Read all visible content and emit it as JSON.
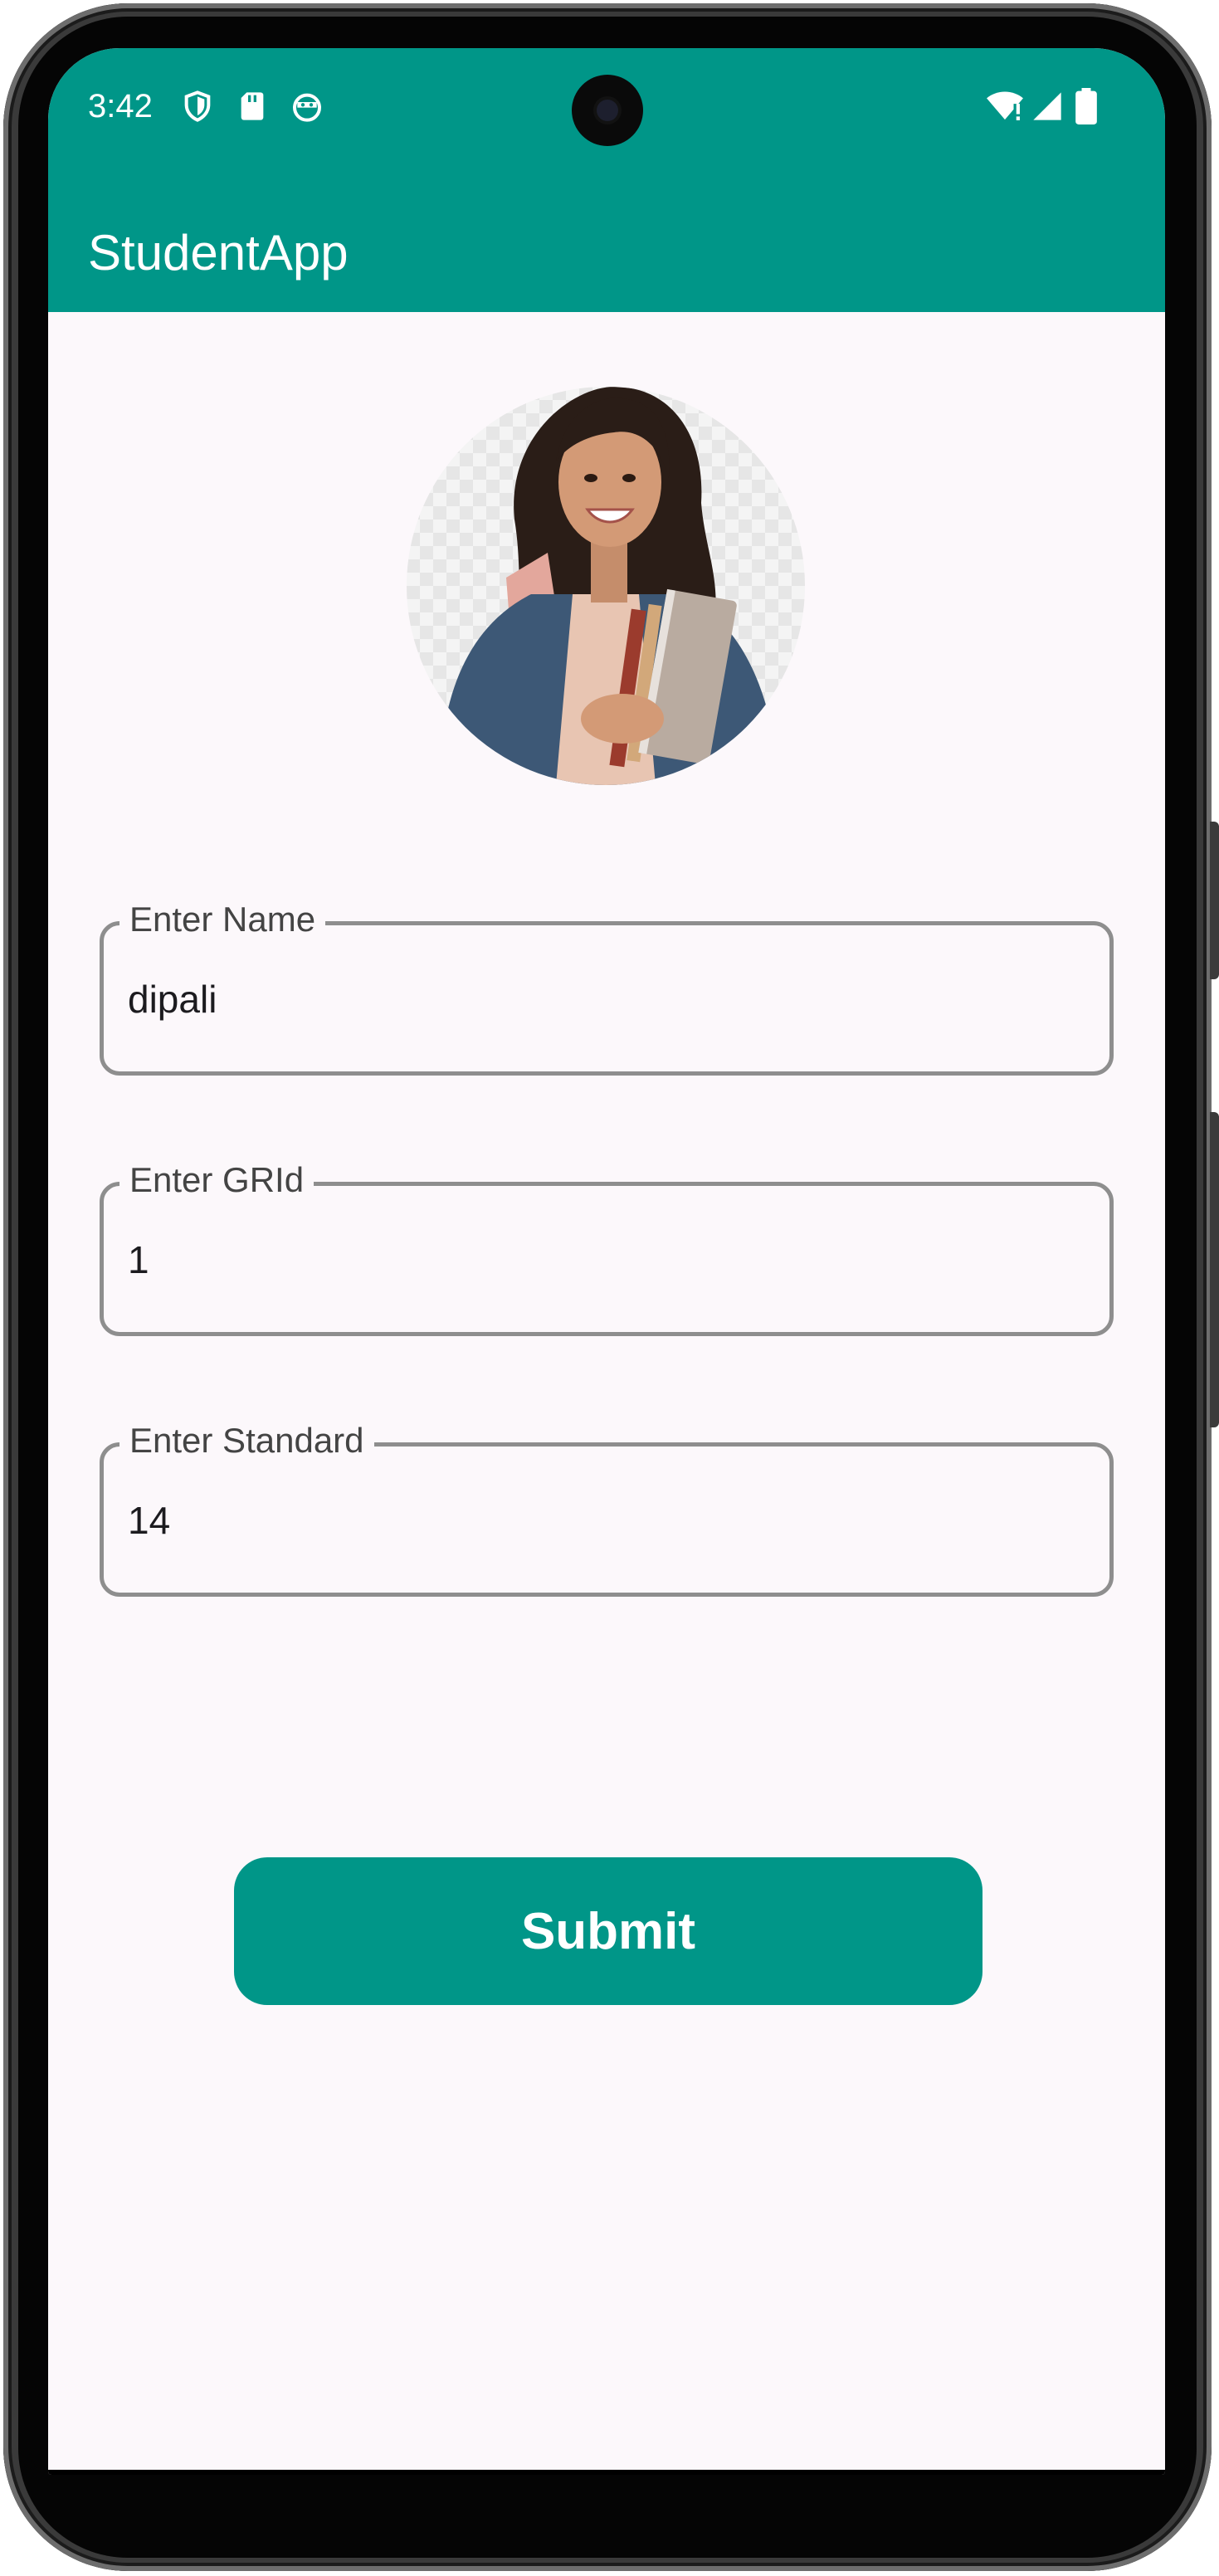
{
  "status_bar": {
    "time": "3:42",
    "left_icons": [
      "shield-icon",
      "sd-card-icon",
      "android-face-icon"
    ],
    "right_icons": [
      "wifi-icon",
      "signal-icon",
      "battery-icon"
    ]
  },
  "app_bar": {
    "title": "StudentApp"
  },
  "profile_image": {
    "icon": "student-photo"
  },
  "form": {
    "name": {
      "label": "Enter Name",
      "value": "dipali"
    },
    "grid": {
      "label": "Enter GRId",
      "value": "1"
    },
    "standard": {
      "label": "Enter Standard",
      "value": "14"
    }
  },
  "submit_label": "Submit",
  "colors": {
    "primary": "#009688",
    "background": "#fcf8fb",
    "outline": "#8e8e8e"
  }
}
